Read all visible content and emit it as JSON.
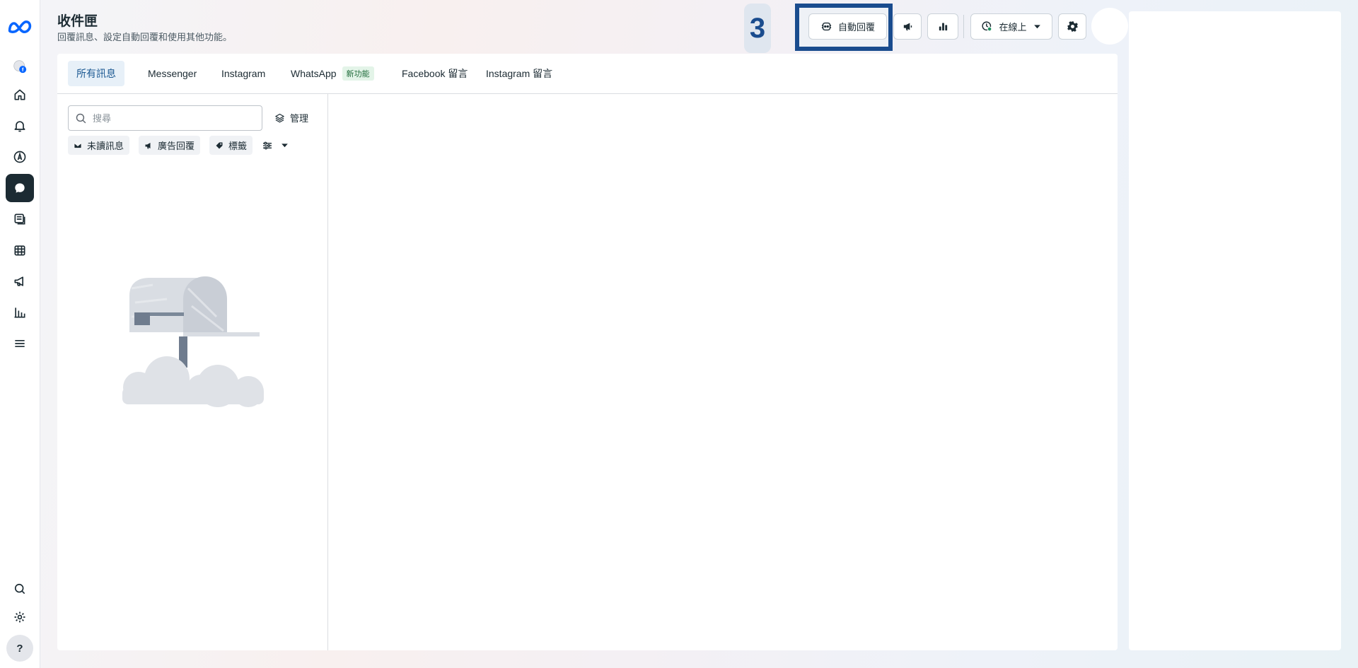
{
  "header": {
    "title": "收件匣",
    "subtitle": "回覆訊息、設定自動回覆和使用其他功能。",
    "step_number": "3",
    "auto_reply_label": "自動回覆",
    "status_label": "在線上"
  },
  "tabs": [
    {
      "label": "所有訊息",
      "active": true
    },
    {
      "label": "Messenger"
    },
    {
      "label": "Instagram"
    },
    {
      "label": "WhatsApp",
      "badge": "新功能"
    },
    {
      "label": "Facebook 留言"
    },
    {
      "label": "Instagram 留言"
    }
  ],
  "search": {
    "placeholder": "搜尋",
    "value": ""
  },
  "manage_label": "管理",
  "filters": [
    {
      "label": "未讀訊息",
      "icon": "envelope-icon"
    },
    {
      "label": "廣告回覆",
      "icon": "megaphone-icon"
    },
    {
      "label": "標籤",
      "icon": "tag-icon"
    }
  ],
  "rail": {
    "help_label": "?",
    "items": [
      "meta-logo-icon",
      "account-avatar-icon",
      "home-icon",
      "bell-icon",
      "compass-icon",
      "chat-icon",
      "content-icon",
      "calendar-icon",
      "megaphone-icon",
      "insights-icon",
      "menu-icon",
      "search-icon",
      "gear-icon"
    ],
    "active_item": "chat-icon"
  },
  "colors": {
    "accent": "#1a4c8e",
    "status_online": "#1f8f5f",
    "active_tab_bg": "#e7f0f8",
    "active_tab_text": "#1d5a93",
    "rail_active_bg": "#1c2b33"
  }
}
